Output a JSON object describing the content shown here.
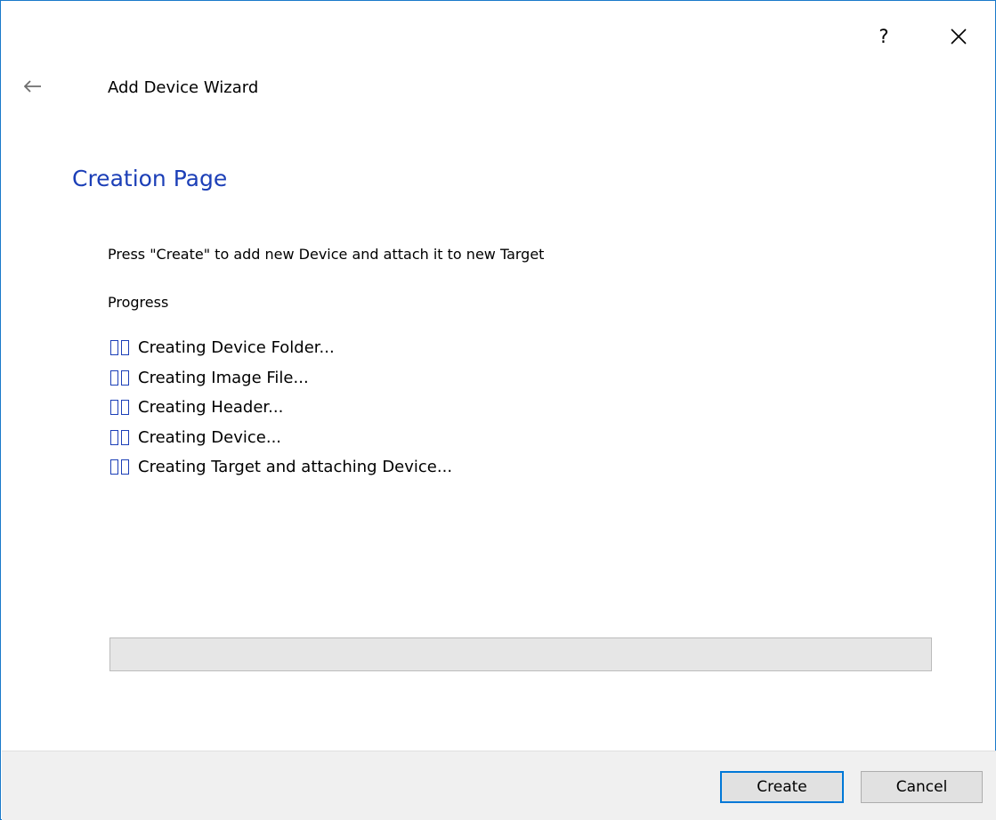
{
  "window": {
    "help_label": "?",
    "wizard_title": "Add Device Wizard",
    "page_title": "Creation Page"
  },
  "content": {
    "instruction": "Press \"Create\" to add new Device and attach it to new Target",
    "progress_label": "Progress",
    "steps": [
      {
        "label": "Creating Device Folder..."
      },
      {
        "label": "Creating Image File..."
      },
      {
        "label": "Creating Header..."
      },
      {
        "label": "Creating Device..."
      },
      {
        "label": "Creating Target and attaching Device..."
      }
    ],
    "progress_percent": 0
  },
  "footer": {
    "create_label": "Create",
    "cancel_label": "Cancel"
  },
  "colors": {
    "accent": "#0078d7",
    "title_blue": "#1c3fb7",
    "border": "#1979ca"
  },
  "icons": {
    "help": "question-mark-icon",
    "close": "close-icon",
    "back": "arrow-left-icon",
    "step": "pending-step-icon"
  }
}
